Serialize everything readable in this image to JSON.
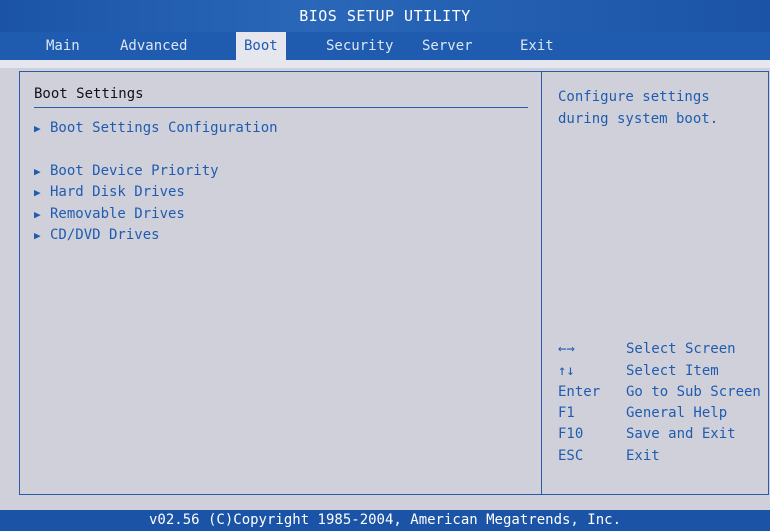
{
  "title": "BIOS SETUP UTILITY",
  "tabs": [
    {
      "label": "Main"
    },
    {
      "label": "Advanced"
    },
    {
      "label": "Boot"
    },
    {
      "label": "Security"
    },
    {
      "label": "Server"
    },
    {
      "label": "Exit"
    }
  ],
  "active_tab": "Boot",
  "section_title": "Boot Settings",
  "menu_items": [
    {
      "label": "Boot Settings Configuration"
    },
    {
      "label": "Boot Device Priority"
    },
    {
      "label": "Hard Disk Drives"
    },
    {
      "label": "Removable Drives"
    },
    {
      "label": "CD/DVD Drives"
    }
  ],
  "help_text": "Configure settings during system boot.",
  "key_legend": [
    {
      "key": "←→",
      "action": "Select Screen"
    },
    {
      "key": "↑↓",
      "action": "Select Item"
    },
    {
      "key": "Enter",
      "action": "Go to Sub Screen"
    },
    {
      "key": "F1",
      "action": "General Help"
    },
    {
      "key": "F10",
      "action": "Save and Exit"
    },
    {
      "key": "ESC",
      "action": "Exit"
    }
  ],
  "footer": "v02.56 (C)Copyright 1985-2004, American Megatrends, Inc.",
  "colors": {
    "title_bar": "#1b54a6",
    "tab_bar": "#1f5cb0",
    "active_tab_bg": "#e6e6ee",
    "body_bg": "#d0d0da",
    "accent_text": "#1f5cb0",
    "border": "#2a5ba8"
  }
}
